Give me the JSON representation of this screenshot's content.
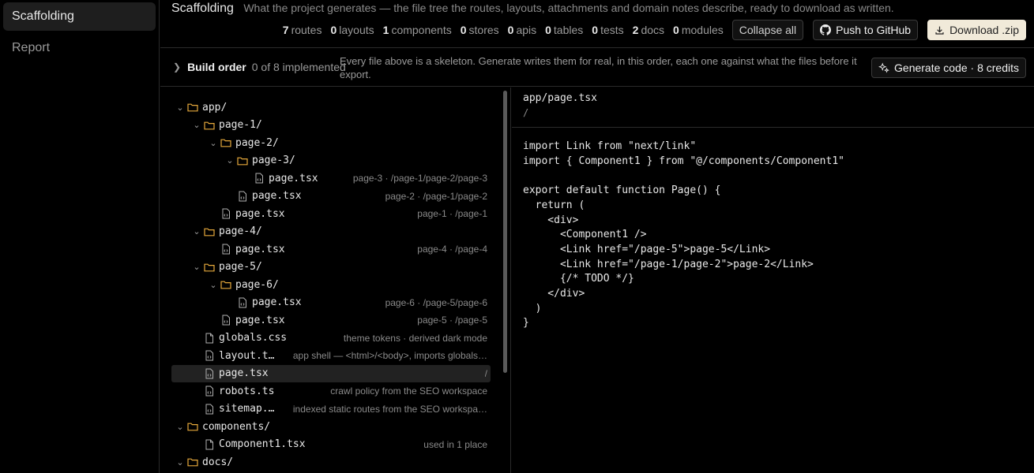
{
  "sidebar": {
    "items": [
      {
        "label": "Scaffolding"
      },
      {
        "label": "Report"
      }
    ]
  },
  "header": {
    "title": "Scaffolding",
    "subtitle": "What the project generates — the file tree the routes, layouts, attachments and domain notes describe, ready to download as written.",
    "stats": [
      {
        "count": "7",
        "label": "routes"
      },
      {
        "count": "0",
        "label": "layouts"
      },
      {
        "count": "1",
        "label": "components"
      },
      {
        "count": "0",
        "label": "stores"
      },
      {
        "count": "0",
        "label": "apis"
      },
      {
        "count": "0",
        "label": "tables"
      },
      {
        "count": "0",
        "label": "tests"
      },
      {
        "count": "2",
        "label": "docs"
      },
      {
        "count": "0",
        "label": "modules"
      }
    ],
    "collapse_label": "Collapse all",
    "github_label": "Push to GitHub",
    "zip_label": "Download .zip"
  },
  "build": {
    "title": "Build order",
    "count": "0 of 8 implemented",
    "desc": "Every file above is a skeleton. Generate writes them for real, in this order, each one against what the files before it export.",
    "generate_label": "Generate code · 8 credits"
  },
  "tree": [
    {
      "depth": 0,
      "type": "folder",
      "name": "app/",
      "meta": ""
    },
    {
      "depth": 1,
      "type": "folder",
      "name": "page-1/",
      "meta": ""
    },
    {
      "depth": 2,
      "type": "folder",
      "name": "page-2/",
      "meta": ""
    },
    {
      "depth": 3,
      "type": "folder",
      "name": "page-3/",
      "meta": ""
    },
    {
      "depth": 4,
      "type": "code",
      "name": "page.tsx",
      "meta": "page-3 · /page-1/page-2/page-3"
    },
    {
      "depth": 3,
      "type": "code",
      "name": "page.tsx",
      "meta": "page-2 · /page-1/page-2"
    },
    {
      "depth": 2,
      "type": "code",
      "name": "page.tsx",
      "meta": "page-1 · /page-1"
    },
    {
      "depth": 1,
      "type": "folder",
      "name": "page-4/",
      "meta": ""
    },
    {
      "depth": 2,
      "type": "code",
      "name": "page.tsx",
      "meta": "page-4 · /page-4"
    },
    {
      "depth": 1,
      "type": "folder",
      "name": "page-5/",
      "meta": ""
    },
    {
      "depth": 2,
      "type": "folder",
      "name": "page-6/",
      "meta": ""
    },
    {
      "depth": 3,
      "type": "code",
      "name": "page.tsx",
      "meta": "page-6 · /page-5/page-6"
    },
    {
      "depth": 2,
      "type": "code",
      "name": "page.tsx",
      "meta": "page-5 · /page-5"
    },
    {
      "depth": 1,
      "type": "file",
      "name": "globals.css",
      "meta": "theme tokens · derived dark mode"
    },
    {
      "depth": 1,
      "type": "code",
      "name": "layout.t…",
      "meta": "app shell — <html>/<body>, imports globals…"
    },
    {
      "depth": 1,
      "type": "code",
      "name": "page.tsx",
      "meta": "/",
      "selected": true
    },
    {
      "depth": 1,
      "type": "code",
      "name": "robots.ts",
      "meta": "crawl policy from the SEO workspace"
    },
    {
      "depth": 1,
      "type": "code",
      "name": "sitemap.…",
      "meta": "indexed static routes from the SEO workspa…"
    },
    {
      "depth": 0,
      "type": "folder",
      "name": "components/",
      "meta": ""
    },
    {
      "depth": 1,
      "type": "file",
      "name": "Component1.tsx",
      "meta": "used in 1 place"
    },
    {
      "depth": 0,
      "type": "folder",
      "name": "docs/",
      "meta": ""
    }
  ],
  "code": {
    "path": "app/page.tsx",
    "route": "/",
    "lines": [
      "import Link from \"next/link\"",
      "import { Component1 } from \"@/components/Component1\"",
      "",
      "export default function Page() {",
      "  return (",
      "    <div>",
      "      <Component1 />",
      "      <Link href=\"/page-5\">page-5</Link>",
      "      <Link href=\"/page-1/page-2\">page-2</Link>",
      "      {/* TODO */}",
      "    </div>",
      "  )",
      "}"
    ]
  },
  "colors": {
    "folder": "#e5a83b",
    "accent_button": "#f1ead9"
  }
}
